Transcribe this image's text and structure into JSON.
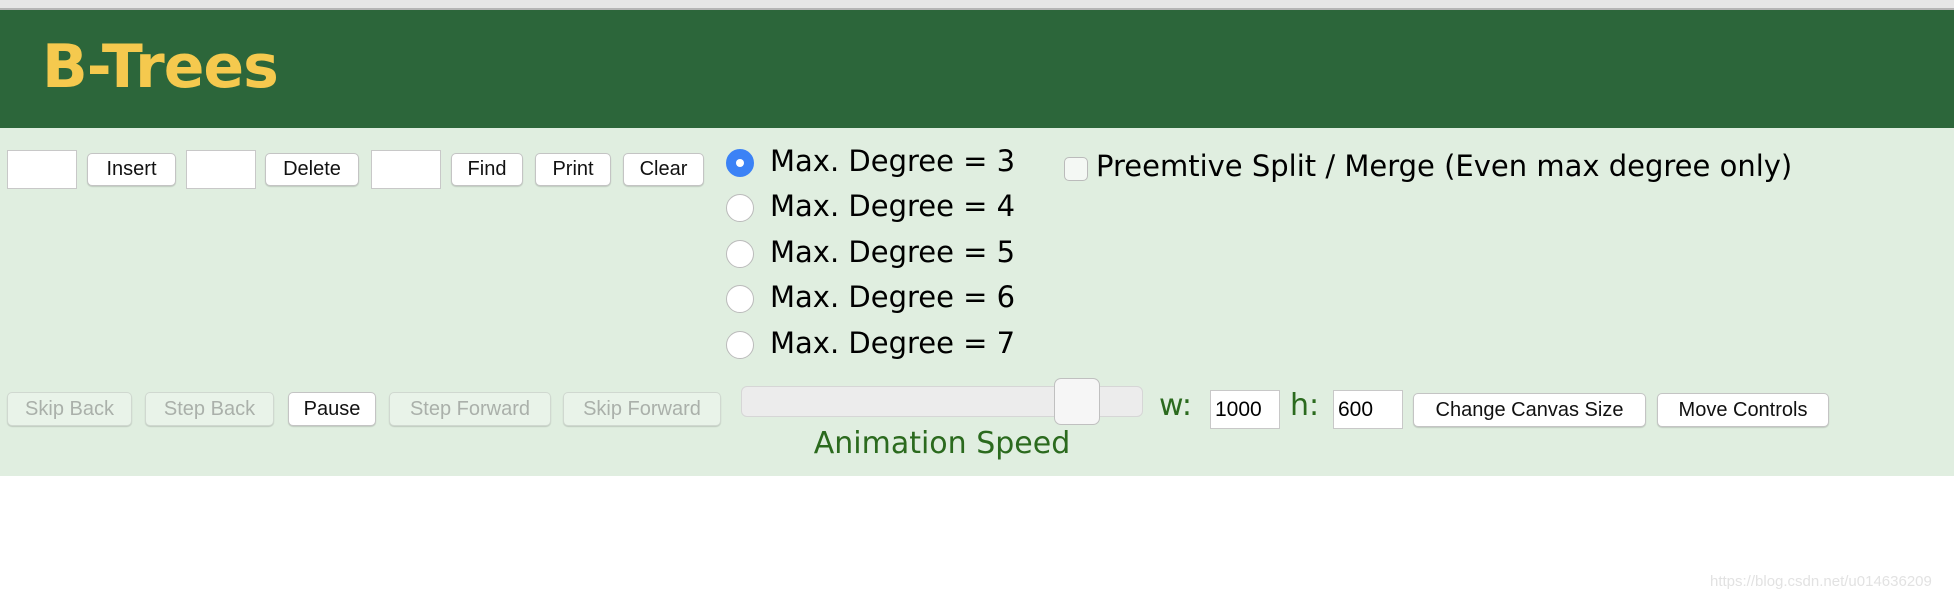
{
  "header": {
    "title": "B-Trees"
  },
  "toolbar": {
    "insert_value": "",
    "insert_label": "Insert",
    "delete_value": "",
    "delete_label": "Delete",
    "find_value": "",
    "find_label": "Find",
    "print_label": "Print",
    "clear_label": "Clear"
  },
  "degree_options": [
    {
      "label": "Max. Degree = 3",
      "selected": true
    },
    {
      "label": "Max. Degree = 4",
      "selected": false
    },
    {
      "label": "Max. Degree = 5",
      "selected": false
    },
    {
      "label": "Max. Degree = 6",
      "selected": false
    },
    {
      "label": "Max. Degree = 7",
      "selected": false
    }
  ],
  "preemptive": {
    "label": "Preemtive Split / Merge (Even max degree only)",
    "checked": false
  },
  "animation": {
    "skip_back": "Skip Back",
    "step_back": "Step Back",
    "pause": "Pause",
    "step_forward": "Step Forward",
    "skip_forward": "Skip Forward",
    "speed_label": "Animation Speed",
    "speed_value_fraction": 0.88
  },
  "canvas": {
    "w_label": "w:",
    "w_value": "1000",
    "h_label": "h:",
    "h_value": "600",
    "change_label": "Change Canvas Size",
    "move_label": "Move Controls"
  },
  "watermark": "https://blog.csdn.net/u014636209",
  "colors": {
    "header_bg": "#2c663a",
    "title": "#f5c94e",
    "panel_bg": "#e0eee0",
    "radio_selected": "#3b82f6",
    "label_green": "#2b6a1e"
  }
}
